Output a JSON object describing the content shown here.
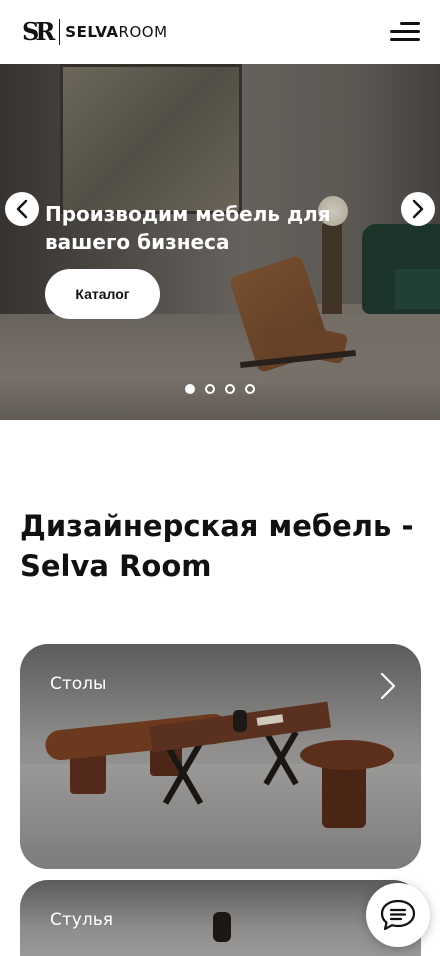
{
  "header": {
    "logo_mark": "SR",
    "logo_word_bold": "SELVA",
    "logo_word": "ROOM",
    "menu_icon": "hamburger-menu-icon"
  },
  "hero": {
    "title": "Производим мебель для вашего бизнеса",
    "button_label": "Каталог",
    "prev_icon": "chevron-left-icon",
    "next_icon": "chevron-right-icon",
    "slides_total": 4,
    "active_slide": 1
  },
  "section": {
    "title": "Дизайнерская мебель - Selva Room"
  },
  "categories": [
    {
      "label": "Столы",
      "icon": "chevron-right-icon"
    },
    {
      "label": "Стулья"
    }
  ],
  "chat": {
    "icon": "chat-bubble-icon"
  },
  "colors": {
    "text": "#111111",
    "background": "#ffffff",
    "accent_white": "#ffffff"
  }
}
